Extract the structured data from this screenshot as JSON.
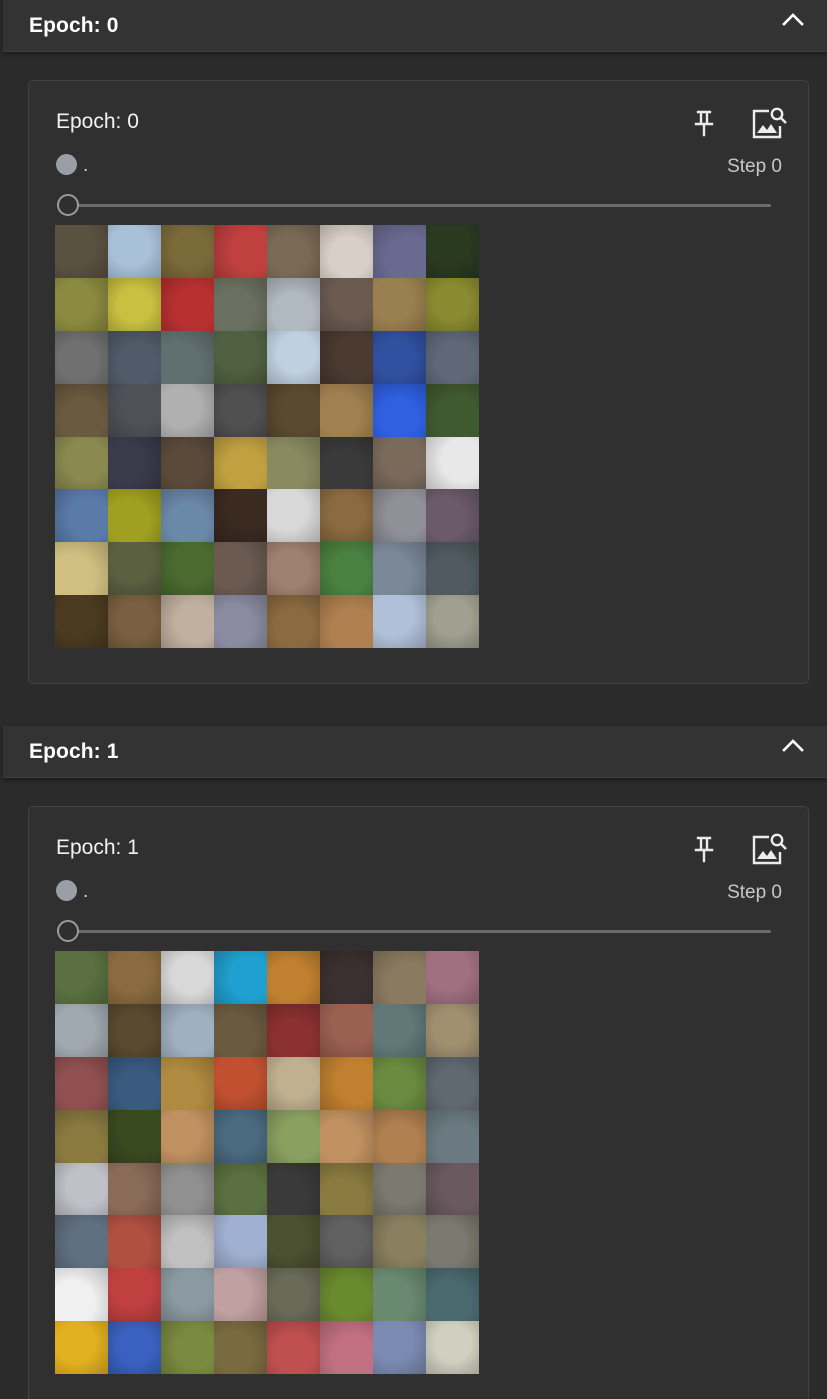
{
  "sections": [
    {
      "header_title": "Epoch: 0",
      "card": {
        "title": "Epoch: 0",
        "run_name": ".",
        "step_text": "Step 0",
        "step_value": 0,
        "slider_fraction": 0.0,
        "grid": {
          "rows": 8,
          "cols": 8,
          "description": "CIFAR-10 sample thumbnails",
          "tile_colors": [
            [
              "#5a5240",
              "#a8c0d8",
              "#7a6a3a",
              "#c04040",
              "#7a6a55",
              "#d8d0c8",
              "#6a6a90",
              "#2a3a20"
            ],
            [
              "#8a8a40",
              "#c8c040",
              "#b83030",
              "#6a7060",
              "#b0b8c0",
              "#6a5a50",
              "#9a8050",
              "#8a8a30"
            ],
            [
              "#707070",
              "#505a68",
              "#607070",
              "#506040",
              "#c0d0e0",
              "#4a3a30",
              "#3050a0",
              "#606878"
            ],
            [
              "#6a5a40",
              "#505058",
              "#b0b0b0",
              "#505050",
              "#5a4a30",
              "#a08050",
              "#3060e0",
              "#405a30"
            ],
            [
              "#8a8a50",
              "#3a3a4a",
              "#5a4a3a",
              "#c0a040",
              "#8a8a60",
              "#3a3a3a",
              "#7a6a5a",
              "#e8e8e8"
            ],
            [
              "#5a7aa8",
              "#a0a020",
              "#6a88a8",
              "#3a2a20",
              "#d8d8d8",
              "#8a6a40",
              "#909098",
              "#6a5a6a"
            ],
            [
              "#d0c080",
              "#5a6040",
              "#4a6a30",
              "#6a5a50",
              "#a08070",
              "#4a8040",
              "#7a8898",
              "#505a60"
            ],
            [
              "#4a3a20",
              "#7a6040",
              "#c0b0a0",
              "#8a8aa0",
              "#8a6a40",
              "#b08050",
              "#b0c0d8",
              "#a0a090"
            ]
          ]
        }
      }
    },
    {
      "header_title": "Epoch: 1",
      "card": {
        "title": "Epoch: 1",
        "run_name": ".",
        "step_text": "Step 0",
        "step_value": 0,
        "slider_fraction": 0.0,
        "grid": {
          "rows": 8,
          "cols": 8,
          "description": "CIFAR-10 sample thumbnails",
          "tile_colors": [
            [
              "#5a7040",
              "#8a6a40",
              "#d8d8d8",
              "#20a0d0",
              "#c08030",
              "#3a3030",
              "#8a7a60",
              "#a07080"
            ],
            [
              "#a0a8b0",
              "#5a4a30",
              "#a0b0c0",
              "#6a5a40",
              "#8a3030",
              "#9a6050",
              "#607878",
              "#a09070"
            ],
            [
              "#905050",
              "#3a5a80",
              "#b08a40",
              "#c05030",
              "#c0b090",
              "#c08030",
              "#6a8a40",
              "#606870"
            ],
            [
              "#8a7a40",
              "#3a4a20",
              "#c09060",
              "#4a6a80",
              "#8aa060",
              "#c09060",
              "#b08050",
              "#6a7a80"
            ],
            [
              "#c0c0c8",
              "#8a6a58",
              "#909090",
              "#5a7040",
              "#3a3a3a",
              "#8a7a40",
              "#7a7a70",
              "#6a5a60"
            ],
            [
              "#607080",
              "#b05040",
              "#c0c0c0",
              "#a0b0d0",
              "#4a5030",
              "#606060",
              "#8a8060",
              "#7a7a70"
            ],
            [
              "#f0f0f0",
              "#c04040",
              "#8a9aa0",
              "#c0a0a0",
              "#6a6a58",
              "#6a8a30",
              "#6a8a70",
              "#4a6a70"
            ],
            [
              "#e0b020",
              "#3a60c0",
              "#7a8a40",
              "#7a6a40",
              "#c05050",
              "#c07080",
              "#7a8ab0",
              "#d0d0c0"
            ]
          ]
        }
      }
    }
  ],
  "icons": {
    "collapse": "chevron-up-icon",
    "pin": "pin-icon",
    "image_search": "image-search-icon"
  },
  "colors": {
    "background": "#2b2b2b",
    "header": "#333333",
    "card": "#303030",
    "run_dot": "#9a9ea6"
  }
}
